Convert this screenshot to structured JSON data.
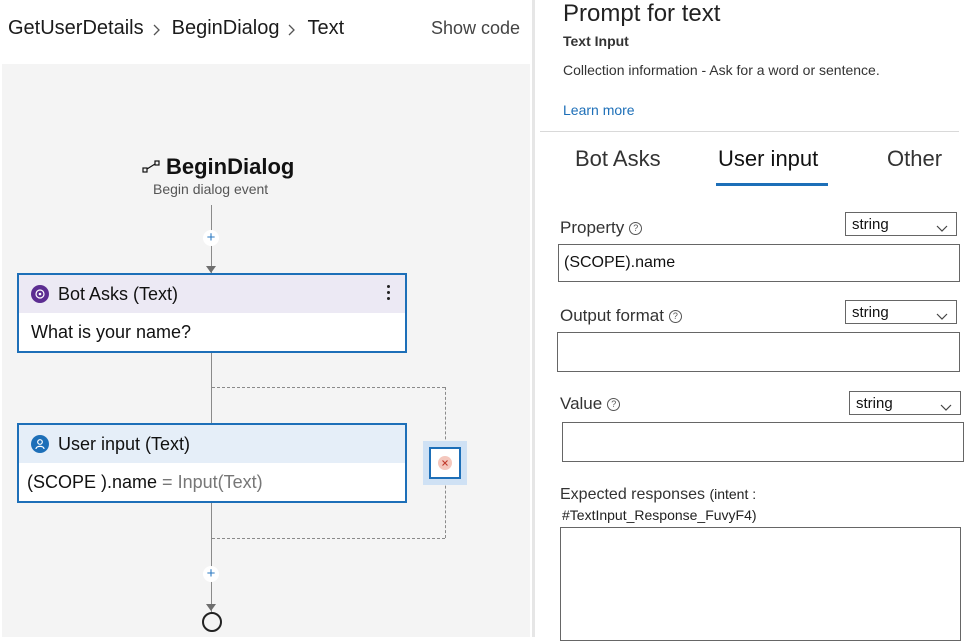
{
  "breadcrumb": {
    "items": [
      "GetUserDetails",
      "BeginDialog",
      "Text"
    ],
    "show_code": "Show code"
  },
  "canvas": {
    "trigger": {
      "title": "BeginDialog",
      "subtitle": "Begin dialog event",
      "icon": "trigger-icon"
    },
    "add_symbol": "+",
    "nodes": {
      "bot_asks": {
        "title": "Bot Asks (Text)",
        "body": "What is your name?",
        "icon": "bot-icon"
      },
      "user_input": {
        "title": "User input (Text)",
        "prop": "(SCOPE ).name",
        "eq": " = ",
        "expr": "Input(Text)",
        "icon": "user-icon"
      }
    }
  },
  "panel": {
    "title": "Prompt for text",
    "subtitle": "Text Input",
    "description": "Collection information - Ask for a word or sentence.",
    "learn_more": "Learn more",
    "tabs": [
      "Bot Asks",
      "User input",
      "Other"
    ],
    "active_tab": "User input",
    "help_symbol": "?",
    "fields": {
      "property": {
        "label": "Property",
        "type": "string",
        "value": "(SCOPE).name"
      },
      "output_format": {
        "label": "Output format",
        "type": "string",
        "value": ""
      },
      "value": {
        "label": "Value",
        "type": "string",
        "value": ""
      }
    },
    "expected": {
      "label": "Expected responses",
      "intent_prefix": "(intent :",
      "intent_id": "#TextInput_Response_FuvyF4)"
    }
  },
  "colors": {
    "accent": "#1d6fb8",
    "bot_badge": "#5c2d91"
  }
}
